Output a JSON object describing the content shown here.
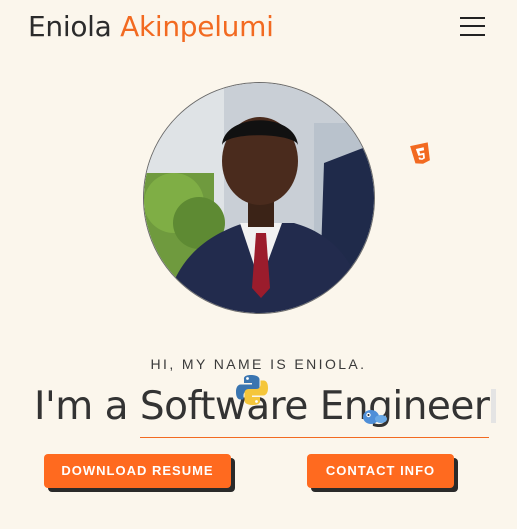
{
  "header": {
    "first_name": "Eniola",
    "last_name": "Akinpelumi",
    "menu_icon": "hamburger-menu-icon"
  },
  "hero": {
    "greeting": "HI, MY NAME IS ENIOLA.",
    "prefix": "I'm a",
    "role": "Software Engineer",
    "floating_icons": [
      "html5-icon",
      "python-icon",
      "go-icon"
    ]
  },
  "buttons": {
    "download_resume": "DOWNLOAD RESUME",
    "contact_info": "CONTACT INFO"
  },
  "colors": {
    "accent": "#ff6a1f",
    "background": "#fbf6ec",
    "text": "#2f2f2f"
  }
}
